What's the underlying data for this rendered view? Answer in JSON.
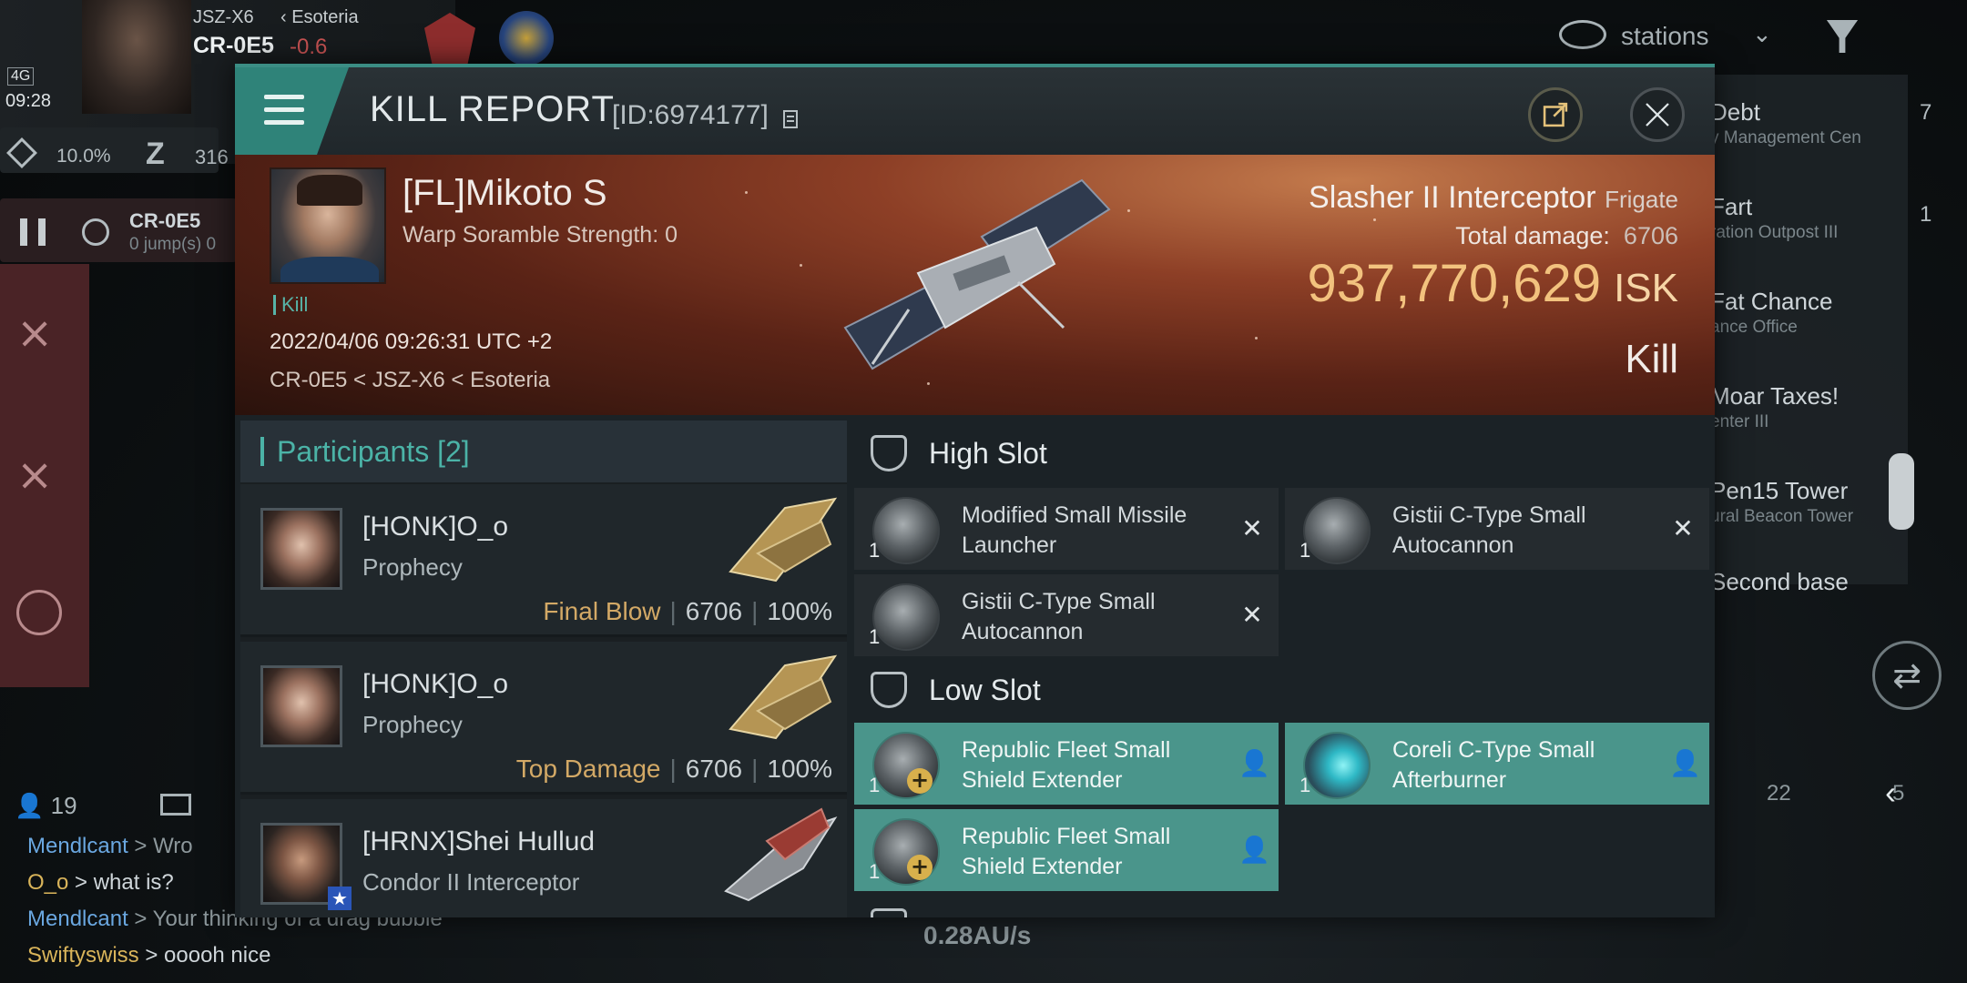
{
  "hud": {
    "corp_ticker": "JSZ-X6",
    "region": "Esoteria",
    "system": "CR-0E5",
    "security": "-0.6",
    "clock": "09:28",
    "network": "4G",
    "cargo_pct": "10.0%",
    "ticker_z": "Z",
    "ticker_num": "316",
    "route_system": "CR-0E5",
    "route_jumps": "0 jump(s) 0",
    "stations_label": "stations",
    "right_counts": [
      "7",
      "1"
    ],
    "local_count": "19",
    "speed": "0.28AU/s",
    "dial_22": "22",
    "dial_5": "5"
  },
  "right_panel": [
    {
      "title": "Debt",
      "sub": "y Management Cen"
    },
    {
      "title": "Fart",
      "sub": "ration Outpost III"
    },
    {
      "title": "Fat Chance",
      "sub": "ance Office"
    },
    {
      "title": "Moar Taxes!",
      "sub": "enter III"
    },
    {
      "title": "Pen15 Tower",
      "sub": "ural Beacon Tower"
    },
    {
      "title": "Second base",
      "sub": ""
    }
  ],
  "chat": [
    {
      "name": "Mendlcant",
      "text": " > Wro",
      "color": "#6aa7e0"
    },
    {
      "name": "O_o",
      "text": " > what is?",
      "color": "#d9b45a"
    },
    {
      "name": "Mendlcant",
      "text": " > Your thinking of a drag bubble",
      "color": "#6aa7e0"
    },
    {
      "name": "Swiftyswiss",
      "text": " > ooooh nice",
      "color": "#d9b45a"
    }
  ],
  "report": {
    "title": "KILL REPORT",
    "id": "[ID:6974177]",
    "victim": {
      "name": "[FL]Mikoto S",
      "warp": "Warp Soramble Strength: 0",
      "tag": "Kill",
      "datetime": "2022/04/06 09:26:31 UTC +2",
      "location": "CR-0E5 < JSZ-X6 < Esoteria"
    },
    "ship": {
      "name": "Slasher II Interceptor",
      "class": "Frigate",
      "damage_label": "Total damage:",
      "damage_value": "6706",
      "isk_value": "937,770,629",
      "isk_unit": "ISK",
      "result": "Kill"
    },
    "participants": {
      "label": "Participants",
      "count": "[2]",
      "rows": [
        {
          "name": "[HONK]O_o",
          "ship": "Prophecy",
          "tag": "Final Blow",
          "damage": "6706",
          "pct": "100%"
        },
        {
          "name": "[HONK]O_o",
          "ship": "Prophecy",
          "tag": "Top Damage",
          "damage": "6706",
          "pct": "100%"
        },
        {
          "name": "[HRNX]Shei Hullud",
          "ship": "Condor II Interceptor",
          "tag": "",
          "damage": "",
          "pct": ""
        }
      ]
    },
    "fitting": {
      "high_label": "High Slot",
      "low_label": "Low Slot",
      "high": [
        {
          "qty": "1",
          "name": "Modified Small Missile Launcher",
          "state": "destroyed"
        },
        {
          "qty": "1",
          "name": "Gistii C-Type Small Autocannon",
          "state": "destroyed"
        },
        {
          "qty": "1",
          "name": "Gistii C-Type Small Autocannon",
          "state": "destroyed"
        }
      ],
      "low": [
        {
          "qty": "1",
          "name": "Republic Fleet Small Shield Extender",
          "state": "dropped"
        },
        {
          "qty": "1",
          "name": "Coreli C-Type Small Afterburner",
          "state": "dropped"
        },
        {
          "qty": "1",
          "name": "Republic Fleet Small Shield Extender",
          "state": "dropped"
        }
      ]
    }
  }
}
